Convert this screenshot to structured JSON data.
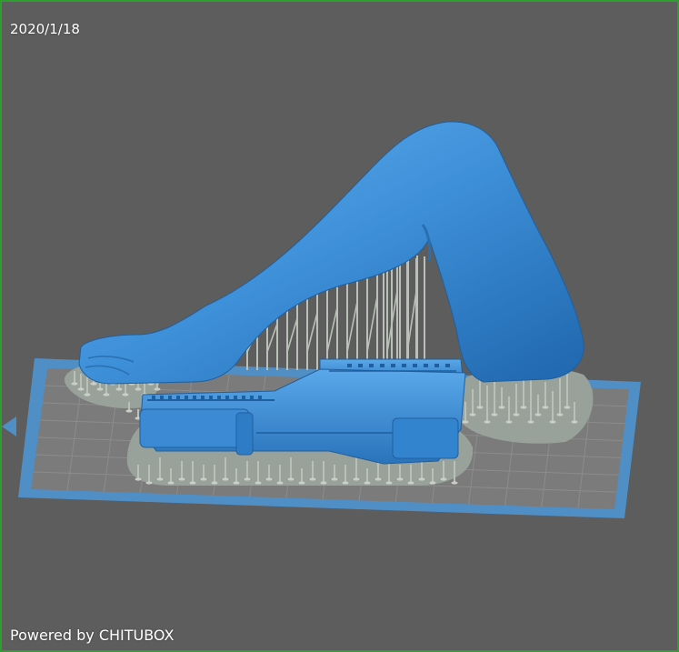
{
  "viewport": {
    "date": "2020/1/18",
    "brand": "Powered by CHITUBOX"
  },
  "colors": {
    "background": "#5d5d5d",
    "frame_border": "#2e9e2e",
    "build_plate_border": "#4f8fc6",
    "build_plate_fill": "#7b7b7b",
    "grid_line": "#8c8c8c",
    "model": "#3d8fd8",
    "supports": "#b9c0b8",
    "raft": "#98a29a"
  },
  "scene": {
    "objects": [
      "build-plate",
      "leg-model",
      "rifle-model",
      "support-structure"
    ]
  }
}
